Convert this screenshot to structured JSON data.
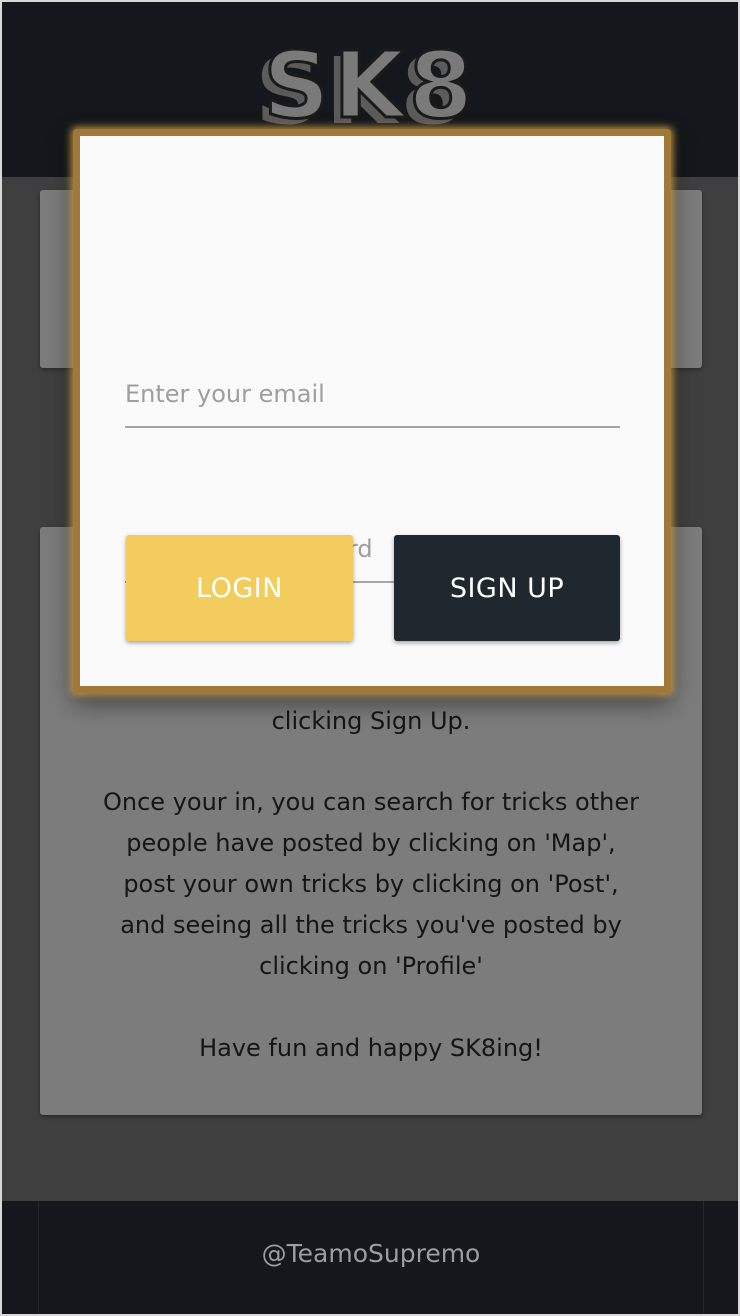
{
  "header": {
    "logo_text": "SK8"
  },
  "main": {
    "paragraphs": [
      "clicking Sign Up.",
      "Once your in, you can search for tricks other",
      "people have posted by clicking on 'Map',",
      "post your own tricks by clicking on 'Post',",
      "and seeing all the tricks you've posted by",
      "clicking on 'Profile'",
      "Have fun and happy SK8ing!"
    ]
  },
  "modal": {
    "email_placeholder": "Enter your email",
    "password_placeholder": "Enter your password",
    "login_label": "LOGIN",
    "signup_label": "SIGN UP"
  },
  "footer": {
    "credit": "@TeamoSupremo"
  },
  "colors": {
    "login_button": "#f2cd5e",
    "signup_button": "#1f282e",
    "header_bg": "#14181c",
    "modal_border": "#a0783a"
  }
}
